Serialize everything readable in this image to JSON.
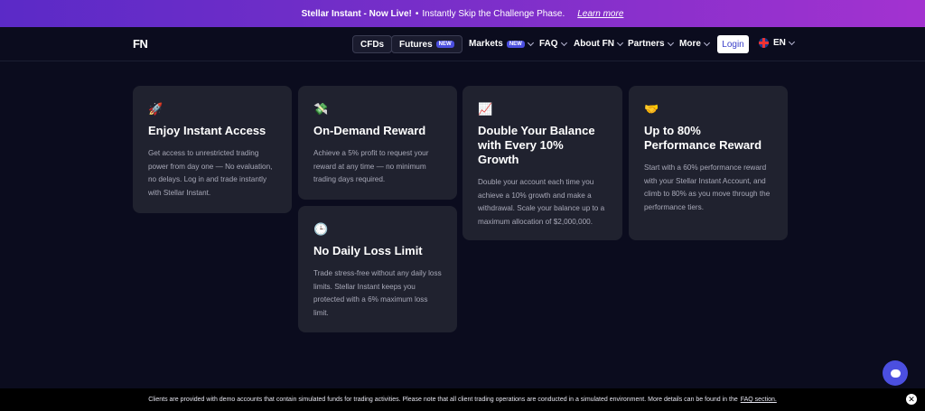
{
  "promo": {
    "title": "Stellar Instant - Now Live!",
    "separator": "•",
    "text": "Instantly Skip the Challenge Phase.",
    "link": "Learn more"
  },
  "nav": {
    "logo": "FN",
    "cfds": "CFDs",
    "futures": "Futures",
    "futures_badge": "NEW",
    "markets": "Markets",
    "markets_badge": "NEW",
    "faq": "FAQ",
    "about": "About FN",
    "partners": "Partners",
    "more": "More",
    "login": "Login",
    "language": "EN"
  },
  "cards": [
    {
      "icon": "🚀",
      "title": "Enjoy Instant Access",
      "text": "Get access to unrestricted trading power from day one — No evaluation, no delays. Log in and trade instantly with Stellar Instant."
    },
    {
      "icon": "💸",
      "title": "On-Demand Reward",
      "text": "Achieve a 5% profit to request your reward at any time — no minimum trading days required."
    },
    {
      "icon": "📈",
      "title": "Double Your Balance with Every 10% Growth",
      "text": "Double your account each time you achieve a 10% growth and make a withdrawal. Scale your balance up to a maximum allocation of $2,000,000."
    },
    {
      "icon": "🤝",
      "title": "Up to 80% Performance Reward",
      "text": "Start with a 60% performance reward with your Stellar Instant Account, and climb to 80% as you move through the performance tiers."
    },
    {
      "icon": "🕒",
      "title": "No Daily Loss Limit",
      "text": "Trade stress-free without any daily loss limits. Stellar Instant keeps you protected with a 6% maximum loss limit."
    }
  ],
  "footer": {
    "text": "Clients are provided with demo accounts that contain simulated funds for trading activities. Please note that all client trading operations are conducted in a simulated environment. More details can be found in the",
    "link": "FAQ section.",
    "close": "✕"
  }
}
